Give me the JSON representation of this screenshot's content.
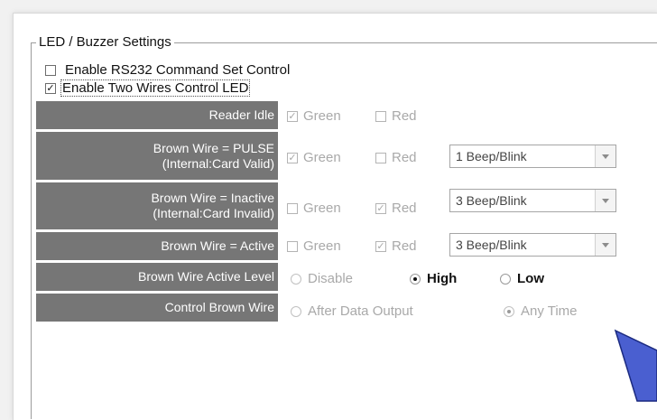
{
  "group": {
    "title": "LED / Buzzer Settings"
  },
  "options": {
    "rs232": {
      "label": "Enable RS232 Command Set Control",
      "checked": false
    },
    "two_wire": {
      "label": "Enable Two Wires Control LED",
      "checked": true
    }
  },
  "check_mark": "✓",
  "rows": [
    {
      "label": [
        "Reader Idle"
      ],
      "green": {
        "label": "Green",
        "checked": true
      },
      "red": {
        "label": "Red",
        "checked": false
      }
    },
    {
      "label": [
        "Brown Wire = PULSE",
        "(Internal:Card Valid)"
      ],
      "green": {
        "label": "Green",
        "checked": true
      },
      "red": {
        "label": "Red",
        "checked": false
      },
      "select": "1 Beep/Blink"
    },
    {
      "label": [
        "Brown Wire = Inactive",
        "(Internal:Card Invalid)"
      ],
      "green": {
        "label": "Green",
        "checked": false
      },
      "red": {
        "label": "Red",
        "checked": true
      },
      "select": "3 Beep/Blink"
    },
    {
      "label": [
        "Brown Wire = Active"
      ],
      "green": {
        "label": "Green",
        "checked": false
      },
      "red": {
        "label": "Red",
        "checked": true
      },
      "select": "3 Beep/Blink"
    }
  ],
  "active_level": {
    "label": "Brown Wire Active Level",
    "options": [
      "Disable",
      "High",
      "Low"
    ],
    "selected": "High"
  },
  "control": {
    "label": "Control Brown Wire",
    "options": [
      "After Data Output",
      "Any Time"
    ],
    "selected": "Any Time"
  },
  "colors": {
    "label_bg": "#767676",
    "arrow_fill": "#4a5fd0",
    "arrow_stroke": "#1b2a80"
  }
}
